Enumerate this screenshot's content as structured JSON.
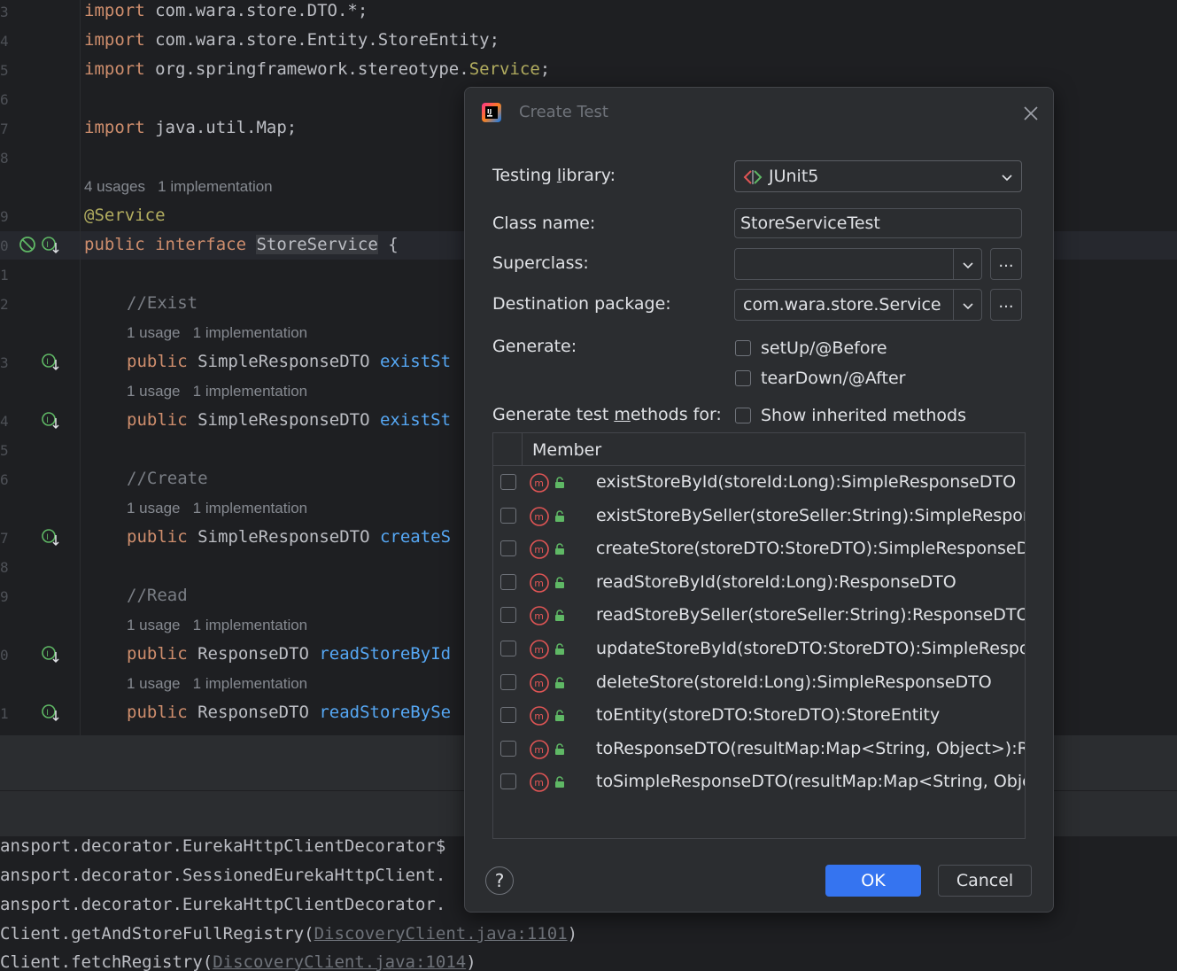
{
  "editor": {
    "line_numbers": [
      "3",
      "4",
      "5",
      "6",
      "7",
      "8",
      "9",
      "0",
      "1",
      "2",
      "3",
      "4",
      "5",
      "6",
      "7",
      "8",
      "9",
      "0",
      "1"
    ],
    "lines": {
      "l3": {
        "kw": "import",
        "rest": " com.wara.store.DTO.*;"
      },
      "l4": {
        "kw": "import",
        "rest": " com.wara.store.Entity.StoreEntity;"
      },
      "l5": {
        "kw": "import",
        "rest": " org.springframework.stereotype.",
        "cls": "Service",
        "end": ";"
      },
      "l7": {
        "kw": "import",
        "rest": " java.util.Map;"
      },
      "hint1": "4 usages   1 implementation",
      "l9": "@Service",
      "l10": {
        "kw": "public interface",
        "name": "StoreService",
        "end": " {"
      },
      "c_exist": "//Exist",
      "hint_u1": "1 usage   1 implementation",
      "l13": {
        "kw": "public",
        "type": " SimpleResponseDTO ",
        "fn": "existSt"
      },
      "hint_u2": "1 usage   1 implementation",
      "l14": {
        "kw": "public",
        "type": " SimpleResponseDTO ",
        "fn": "existSt"
      },
      "c_create": "//Create",
      "hint_u3": "1 usage   1 implementation",
      "l17": {
        "kw": "public",
        "type": " SimpleResponseDTO ",
        "fn": "createS"
      },
      "c_read": "//Read",
      "hint_u4": "1 usage   1 implementation",
      "l20": {
        "kw": "public",
        "type": " ResponseDTO ",
        "fn": "readStoreById"
      },
      "hint_u5": "1 usage   1 implementation",
      "l21": {
        "kw": "public",
        "type": " ResponseDTO ",
        "fn": "readStoreBySe"
      }
    }
  },
  "console": {
    "lines": [
      {
        "text": "ansport.decorator.EurekaHttpClientDecorator$"
      },
      {
        "text": "ansport.decorator.SessionedEurekaHttpClient."
      },
      {
        "text": "ansport.decorator.EurekaHttpClientDecorator."
      },
      {
        "text": "Client.getAndStoreFullRegistry(",
        "link": "DiscoveryClient.java:1101",
        "end": ")"
      },
      {
        "text": "Client.fetchRegistry(",
        "link": "DiscoveryClient.java:1014",
        "end": ")"
      }
    ]
  },
  "dialog": {
    "title": "Create Test",
    "testing_library_label_pre": "Testing ",
    "testing_library_label_ul": "l",
    "testing_library_label_post": "ibrary:",
    "testing_library_value": "JUnit5",
    "class_name_label": "Class name:",
    "class_name_value": "StoreServiceTest",
    "superclass_label": "Superclass:",
    "superclass_value": "",
    "dest_package_label": "Destination package:",
    "dest_package_value": "com.wara.store.Service",
    "browse_label": "...",
    "generate_label": "Generate:",
    "setup_label": "setUp/@Before",
    "teardown_label": "tearDown/@After",
    "methods_label_pre": "Generate test ",
    "methods_label_ul": "m",
    "methods_label_post": "ethods for:",
    "show_inherited_label": "Show inherited methods",
    "table_header": "Member",
    "members": [
      "existStoreById(storeId:Long):SimpleResponseDTO",
      "existStoreBySeller(storeSeller:String):SimpleResponseDTO",
      "createStore(storeDTO:StoreDTO):SimpleResponseDTO",
      "readStoreById(storeId:Long):ResponseDTO",
      "readStoreBySeller(storeSeller:String):ResponseDTO",
      "updateStoreById(storeDTO:StoreDTO):SimpleResponseDTO",
      "deleteStore(storeId:Long):SimpleResponseDTO",
      "toEntity(storeDTO:StoreDTO):StoreEntity",
      "toResponseDTO(resultMap:Map<String, Object>):ResponseDTO",
      "toSimpleResponseDTO(resultMap:Map<String, Object>):SimpleResponseDTO"
    ],
    "help_label": "?",
    "ok_label": "OK",
    "cancel_label": "Cancel"
  },
  "colors": {
    "accent": "#3574f0",
    "keyword": "#cf8e6d",
    "method_icon": "#e05555"
  },
  "icons": [
    "app-icon",
    "close-icon",
    "junit-icon",
    "chevron-down-icon",
    "method-icon",
    "lock-icon",
    "implemented-icon",
    "no-entry-icon",
    "help-icon"
  ]
}
